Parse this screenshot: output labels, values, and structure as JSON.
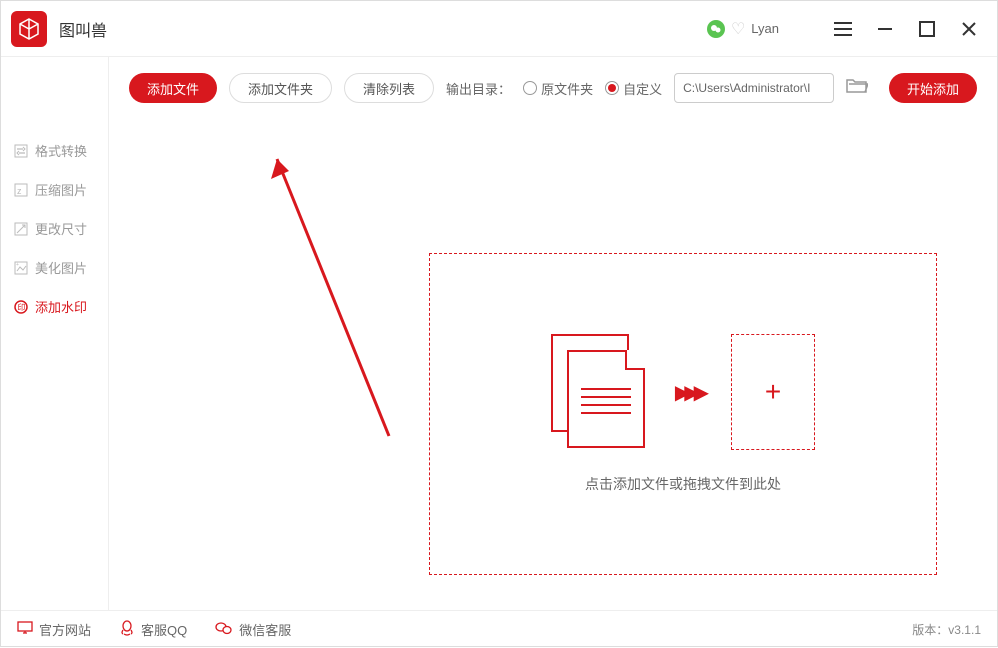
{
  "app": {
    "title": "图叫兽",
    "user": "Lyan"
  },
  "sidebar": {
    "items": [
      {
        "label": "格式转换"
      },
      {
        "label": "压缩图片"
      },
      {
        "label": "更改尺寸"
      },
      {
        "label": "美化图片"
      },
      {
        "label": "添加水印"
      }
    ]
  },
  "toolbar": {
    "add_file": "添加文件",
    "add_folder": "添加文件夹",
    "clear_list": "清除列表",
    "output_label": "输出目录：",
    "radio_original": "原文件夹",
    "radio_custom": "自定义",
    "path_value": "C:\\Users\\Administrator\\I",
    "start": "开始添加"
  },
  "dropzone": {
    "text": "点击添加文件或拖拽文件到此处",
    "plus": "+"
  },
  "footer": {
    "site": "官方网站",
    "qq": "客服QQ",
    "wechat": "微信客服",
    "version": "版本：v3.1.1"
  }
}
